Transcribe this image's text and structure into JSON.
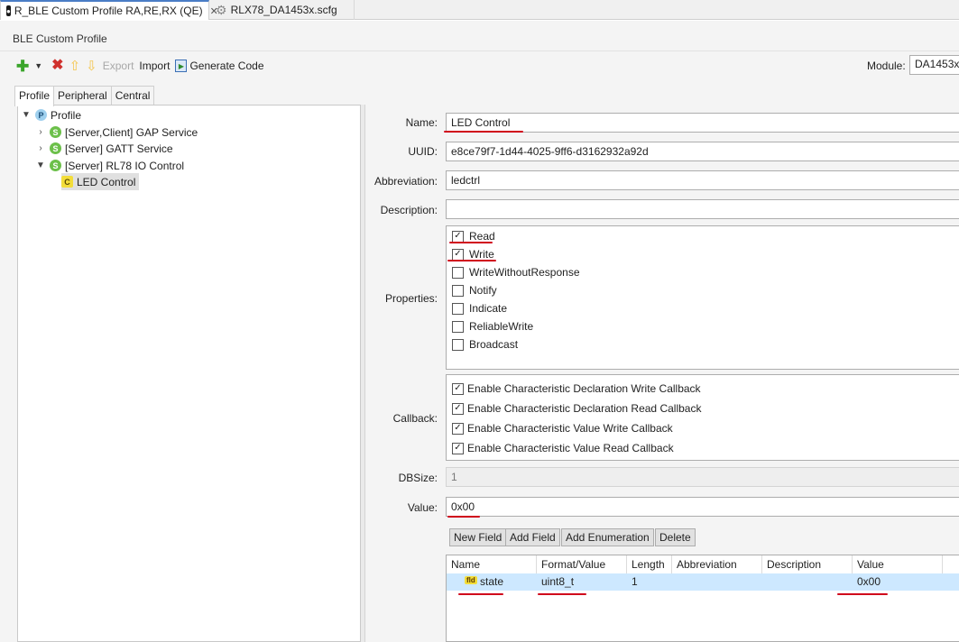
{
  "tabs": [
    {
      "label": "R_BLE Custom Profile RA,RE,RX (QE)",
      "close": "✕"
    },
    {
      "label": "RLX78_DA1453x.scfg"
    }
  ],
  "editor": {
    "title": "BLE Custom Profile",
    "toolbar": {
      "export": "Export",
      "import": "Import",
      "generate": "Generate Code"
    },
    "module_label": "Module:",
    "module_value": "DA1453x"
  },
  "sub_tabs": [
    "Profile",
    "Peripheral",
    "Central"
  ],
  "tree": {
    "root": {
      "badge": "P",
      "label": "Profile"
    },
    "services": [
      {
        "badge": "S",
        "label": "[Server,Client] GAP Service",
        "expanded": false
      },
      {
        "badge": "S",
        "label": "[Server] GATT Service",
        "expanded": false
      },
      {
        "badge": "S",
        "label": "[Server] RL78 IO Control",
        "expanded": true
      }
    ],
    "characteristic": {
      "badge": "C",
      "label": "LED Control"
    }
  },
  "form": {
    "name_label": "Name:",
    "name_value": "LED Control",
    "uuid_label": "UUID:",
    "uuid_value": "e8ce79f7-1d44-4025-9ff6-d3162932a92d",
    "abbr_label": "Abbreviation:",
    "abbr_value": "ledctrl",
    "desc_label": "Description:",
    "desc_value": "",
    "props_label": "Properties:",
    "properties": [
      {
        "label": "Read",
        "checked": true
      },
      {
        "label": "Write",
        "checked": true
      },
      {
        "label": "WriteWithoutResponse",
        "checked": false
      },
      {
        "label": "Notify",
        "checked": false
      },
      {
        "label": "Indicate",
        "checked": false
      },
      {
        "label": "ReliableWrite",
        "checked": false
      },
      {
        "label": "Broadcast",
        "checked": false
      }
    ],
    "callback_label": "Callback:",
    "callbacks": [
      {
        "label": "Enable Characteristic Declaration Write Callback",
        "checked": true
      },
      {
        "label": "Enable Characteristic Declaration Read Callback",
        "checked": true
      },
      {
        "label": "Enable Characteristic Value Write Callback",
        "checked": true
      },
      {
        "label": "Enable Characteristic Value Read Callback",
        "checked": true
      }
    ],
    "dbsize_label": "DBSize:",
    "dbsize_value": "1",
    "value_label": "Value:",
    "value_value": "0x00",
    "buttons": {
      "new_field": "New Field",
      "add_field": "Add Field",
      "add_enum": "Add Enumeration",
      "delete": "Delete"
    },
    "table": {
      "headers": [
        "Name",
        "Format/Value",
        "Length",
        "Abbreviation",
        "Description",
        "Value"
      ],
      "rows": [
        {
          "badge": "fld",
          "name": "state",
          "format": "uint8_t",
          "length": "1",
          "abbreviation": "",
          "description": "",
          "value": "0x00"
        }
      ]
    }
  },
  "colors": {
    "annotation": "#d0021b",
    "selection": "#cde8ff",
    "accent": "#4a7dc5"
  }
}
